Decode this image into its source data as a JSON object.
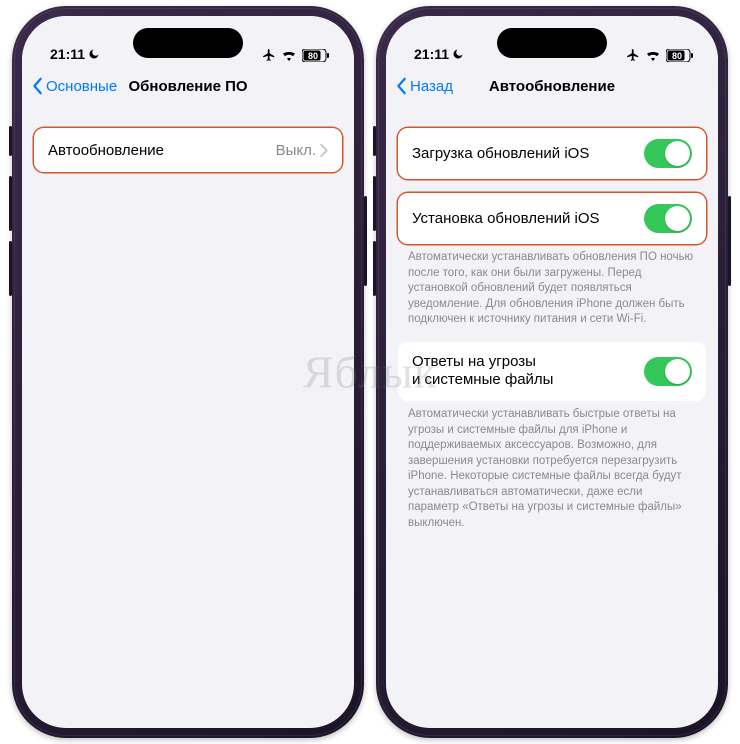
{
  "watermark": "Яблык",
  "status": {
    "time": "21:11",
    "battery": "80"
  },
  "left_phone": {
    "back_label": "Основные",
    "title": "Обновление ПО",
    "row": {
      "label": "Автообновление",
      "value": "Выкл."
    }
  },
  "right_phone": {
    "back_label": "Назад",
    "title": "Автообновление",
    "row1": {
      "label": "Загрузка обновлений iOS"
    },
    "row2": {
      "label": "Установка обновлений iOS"
    },
    "note1": "Автоматически устанавливать обновления ПО ночью после того, как они были загружены. Перед установкой обновлений будет появляться уведомление. Для обновления iPhone должен быть подключен к источнику питания и сети Wi-Fi.",
    "row3": {
      "line1": "Ответы на угрозы",
      "line2": "и системные файлы"
    },
    "note2": "Автоматически устанавливать быстрые ответы на угрозы и системные файлы для iPhone и поддерживаемых аксессуаров. Возможно, для завершения установки потребуется перезагрузить iPhone. Некоторые системные файлы всегда будут устанавливаться автоматически, даже если параметр «Ответы на угрозы и системные файлы» выключен."
  }
}
